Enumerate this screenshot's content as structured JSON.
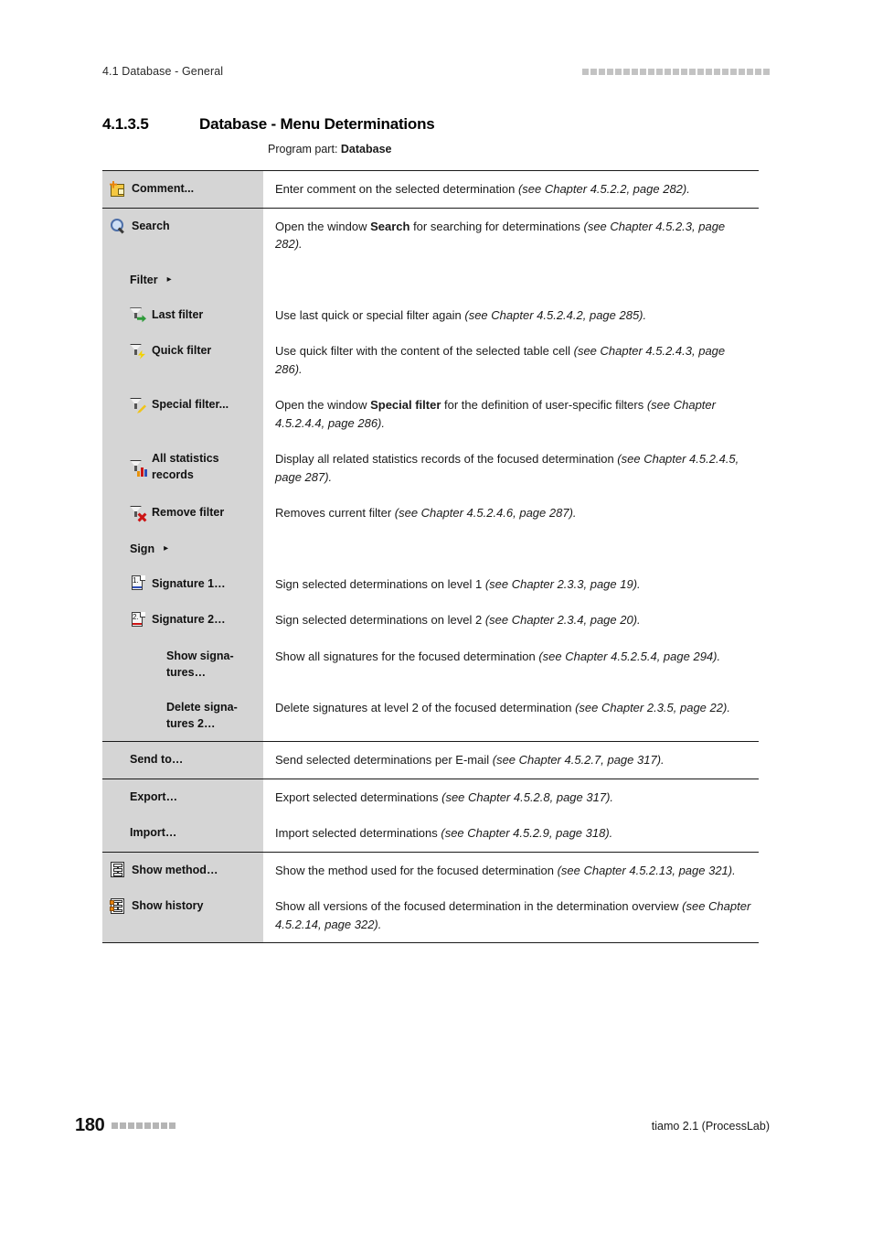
{
  "header": {
    "running_head": "4.1 Database - General",
    "decoration_squares": 23
  },
  "heading": {
    "number": "4.1.3.5",
    "title": "Database - Menu Determinations"
  },
  "program_part": {
    "label": "Program part:",
    "value": "Database"
  },
  "groups": [
    {
      "rows": [
        {
          "icon": "comment-note-icon",
          "label": "Comment...",
          "indent": 0,
          "desc_parts": [
            {
              "text": "Enter comment on the selected determination ",
              "style": "normal"
            },
            {
              "text": "(see Chapter 4.5.2.2, page 282).",
              "style": "italic"
            }
          ]
        }
      ]
    },
    {
      "rows": [
        {
          "icon": "magnifier-search-icon",
          "label": "Search",
          "indent": 0,
          "desc_parts": [
            {
              "text": "Open the window ",
              "style": "normal"
            },
            {
              "text": "Search",
              "style": "bold"
            },
            {
              "text": " for searching for determinations ",
              "style": "normal"
            },
            {
              "text": "(see Chapter 4.5.2.3, page 282).",
              "style": "italic"
            }
          ]
        },
        {
          "icon": "none",
          "label": "Filter",
          "submenu_arrow": "▸",
          "indent": 1,
          "desc_parts": []
        },
        {
          "icon": "funnel-arrow-icon",
          "label": "Last filter",
          "indent": 1,
          "desc_parts": [
            {
              "text": "Use last quick or special filter again ",
              "style": "normal"
            },
            {
              "text": "(see Chapter 4.5.2.4.2, page 285).",
              "style": "italic"
            }
          ]
        },
        {
          "icon": "funnel-bolt-icon",
          "label": "Quick filter",
          "indent": 1,
          "desc_parts": [
            {
              "text": "Use quick filter with the content of the selected table cell ",
              "style": "normal"
            },
            {
              "text": "(see Chapter 4.5.2.4.3, page 286).",
              "style": "italic"
            }
          ]
        },
        {
          "icon": "funnel-pencil-icon",
          "label": "Special filter...",
          "indent": 1,
          "desc_parts": [
            {
              "text": "Open the window ",
              "style": "normal"
            },
            {
              "text": "Special filter",
              "style": "bold"
            },
            {
              "text": " for the definition of user-specific filters ",
              "style": "normal"
            },
            {
              "text": "(see Chapter 4.5.2.4.4, page 286).",
              "style": "italic"
            }
          ]
        },
        {
          "icon": "funnel-chart-icon",
          "label": "All statistics records",
          "indent": 1,
          "two_line": true,
          "desc_parts": [
            {
              "text": "Display all related statistics records of the focused determination ",
              "style": "normal"
            },
            {
              "text": "(see Chapter 4.5.2.4.5, page 287).",
              "style": "italic"
            }
          ]
        },
        {
          "icon": "funnel-remove-icon",
          "label": "Remove filter",
          "indent": 1,
          "desc_parts": [
            {
              "text": "Removes current filter ",
              "style": "normal"
            },
            {
              "text": "(see Chapter 4.5.2.4.6, page 287).",
              "style": "italic"
            }
          ]
        },
        {
          "icon": "none",
          "label": "Sign",
          "submenu_arrow": "▸",
          "indent": 1,
          "desc_parts": []
        },
        {
          "icon": "signature-1-icon",
          "label": "Signature 1…",
          "indent": 1,
          "desc_parts": [
            {
              "text": "Sign selected determinations on level 1 ",
              "style": "normal"
            },
            {
              "text": "(see Chapter 2.3.3, page 19).",
              "style": "italic"
            }
          ]
        },
        {
          "icon": "signature-2-icon",
          "label": "Signature 2…",
          "indent": 1,
          "desc_parts": [
            {
              "text": "Sign selected determinations on level 2 ",
              "style": "normal"
            },
            {
              "text": "(see Chapter 2.3.4, page 20).",
              "style": "italic"
            }
          ]
        },
        {
          "icon": "none",
          "label": "Show signa-tures…",
          "indent": 2,
          "two_line": true,
          "desc_parts": [
            {
              "text": "Show all signatures for the focused determination ",
              "style": "normal"
            },
            {
              "text": "(see Chapter 4.5.2.5.4, page 294).",
              "style": "italic"
            }
          ]
        },
        {
          "icon": "none",
          "label": "Delete signa-tures 2…",
          "indent": 2,
          "two_line": true,
          "desc_parts": [
            {
              "text": "Delete signatures at level 2 of the focused determination ",
              "style": "normal"
            },
            {
              "text": "(see Chapter 2.3.5, page 22).",
              "style": "italic"
            }
          ]
        }
      ]
    },
    {
      "rows": [
        {
          "icon": "none",
          "label": "Send to…",
          "indent": 1,
          "desc_parts": [
            {
              "text": "Send selected determinations per E-mail ",
              "style": "normal"
            },
            {
              "text": "(see Chapter 4.5.2.7, page 317).",
              "style": "italic"
            }
          ]
        }
      ]
    },
    {
      "rows": [
        {
          "icon": "none",
          "label": "Export…",
          "indent": 1,
          "desc_parts": [
            {
              "text": "Export selected determinations ",
              "style": "normal"
            },
            {
              "text": "(see Chapter 4.5.2.8, page 317).",
              "style": "italic"
            }
          ]
        },
        {
          "icon": "none",
          "label": "Import…",
          "indent": 1,
          "desc_parts": [
            {
              "text": "Import selected determinations ",
              "style": "normal"
            },
            {
              "text": "(see Chapter 4.5.2.9, page 318).",
              "style": "italic"
            }
          ]
        }
      ]
    },
    {
      "rows": [
        {
          "icon": "show-method-icon",
          "label": "Show method…",
          "indent": 0,
          "desc_parts": [
            {
              "text": "Show the method used for the focused determination ",
              "style": "normal"
            },
            {
              "text": "(see Chapter 4.5.2.13, page 321).",
              "style": "italic"
            }
          ]
        },
        {
          "icon": "show-history-icon",
          "label": "Show history",
          "indent": 0,
          "desc_parts": [
            {
              "text": "Show all versions of the focused determination in the determination overview ",
              "style": "normal"
            },
            {
              "text": "(see Chapter 4.5.2.14, page 322).",
              "style": "italic"
            }
          ]
        }
      ]
    }
  ],
  "footer": {
    "page_number": "180",
    "decoration_squares": 8,
    "product": "tiamo 2.1 (ProcessLab)"
  },
  "colors": {
    "left_column_bg": "#d5d5d5",
    "rule": "#1a1a1a",
    "square": "#c3c3c3"
  }
}
